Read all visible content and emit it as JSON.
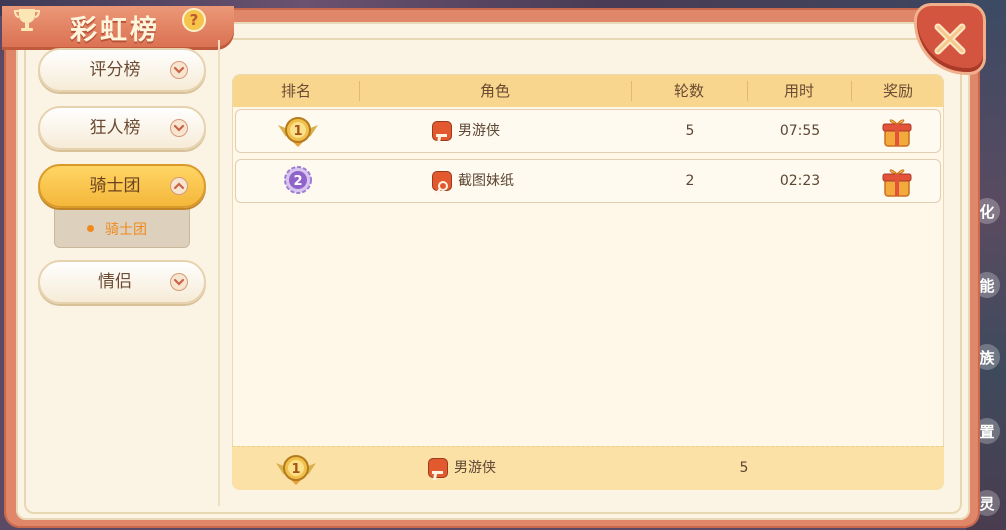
{
  "window": {
    "title": "彩虹榜"
  },
  "sidebar": {
    "items": [
      {
        "label": "评分榜",
        "expanded": false
      },
      {
        "label": "狂人榜",
        "expanded": false
      },
      {
        "label": "骑士团",
        "expanded": true
      },
      {
        "label": "情侣",
        "expanded": false
      }
    ],
    "sub_item": "骑士团"
  },
  "table": {
    "headers": [
      "排名",
      "角色",
      "轮数",
      "用时",
      "奖励"
    ],
    "rows": [
      {
        "rank": 1,
        "rank_icon": "rank-1-gold-medal-icon",
        "char_icon": "gun-icon",
        "name": "男游侠",
        "rounds": "5",
        "time": "07:55",
        "reward": "gift-box-icon"
      },
      {
        "rank": 2,
        "rank_icon": "rank-2-purple-medal-icon",
        "char_icon": "magnifier-icon",
        "name": "截图妹纸",
        "rounds": "2",
        "time": "02:23",
        "reward": "gift-box-icon"
      }
    ],
    "footer": {
      "rank": 1,
      "rank_icon": "rank-1-gold-medal-icon",
      "char_icon": "gun-icon",
      "name": "男游侠",
      "rounds": "5"
    }
  },
  "background_glyphs": [
    "化",
    "能",
    "族",
    "置",
    "灵"
  ],
  "colors": {
    "frame": "#e0876a",
    "panel": "#fbf4e4",
    "header": "#f8d68e",
    "active_tab": "#f4b73a",
    "close": "#d4553f"
  }
}
